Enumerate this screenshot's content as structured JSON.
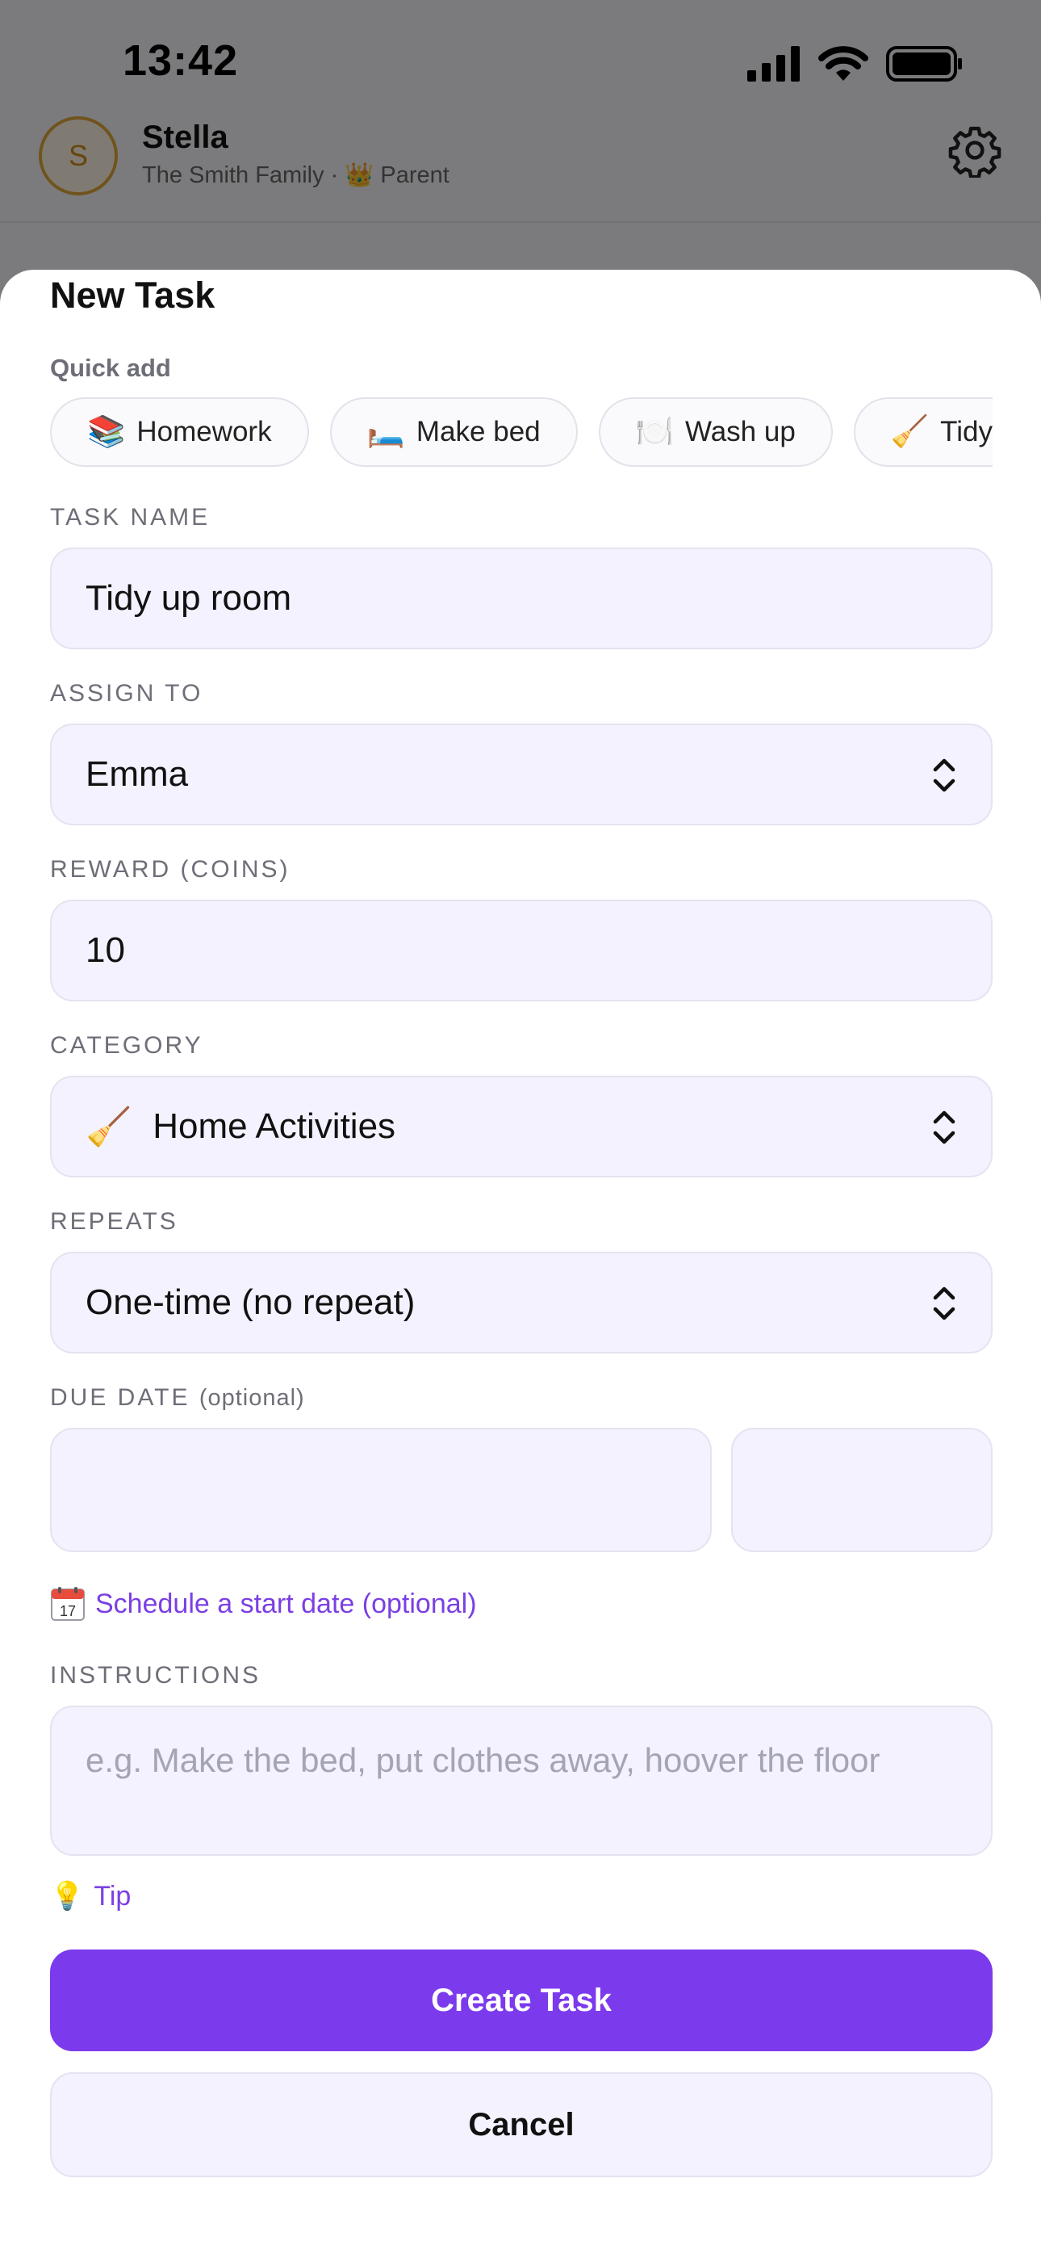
{
  "status_bar": {
    "time": "13:42"
  },
  "app_header": {
    "avatar_initial": "S",
    "user_name": "Stella",
    "family_name": "The Smith Family",
    "separator": "·",
    "role_icon": "👑",
    "role": "Parent"
  },
  "sheet": {
    "title": "New Task",
    "quick_add_label": "Quick add",
    "quick_add": [
      {
        "emoji": "📚",
        "label": "Homework"
      },
      {
        "emoji": "🛏️",
        "label": "Make bed"
      },
      {
        "emoji": "🍽️",
        "label": "Wash up"
      },
      {
        "emoji": "🧹",
        "label": "Tidy up room"
      }
    ],
    "task_name": {
      "label": "TASK NAME",
      "value": "Tidy up room"
    },
    "assign_to": {
      "label": "ASSIGN TO",
      "value": "Emma"
    },
    "reward": {
      "label": "REWARD (COINS)",
      "value": "10"
    },
    "category": {
      "label": "CATEGORY",
      "emoji": "🧹",
      "value": "Home Activities"
    },
    "repeats": {
      "label": "REPEATS",
      "value": "One-time (no repeat)"
    },
    "due_date": {
      "label": "DUE DATE",
      "optional": "(optional)"
    },
    "schedule_link": {
      "icon": "calendar-icon",
      "calendar_day": "17",
      "label": "Schedule a start date (optional)"
    },
    "instructions": {
      "label": "INSTRUCTIONS",
      "placeholder": "e.g. Make the bed, put clothes away, hoover the floor"
    },
    "tip": {
      "emoji": "💡",
      "label": "Tip"
    },
    "create_button": "Create Task",
    "cancel_button": "Cancel"
  },
  "colors": {
    "accent": "#7c3aed",
    "link": "#7b3fe4",
    "field_bg": "#f3f2fe",
    "avatar_ring": "#e0a73a"
  }
}
